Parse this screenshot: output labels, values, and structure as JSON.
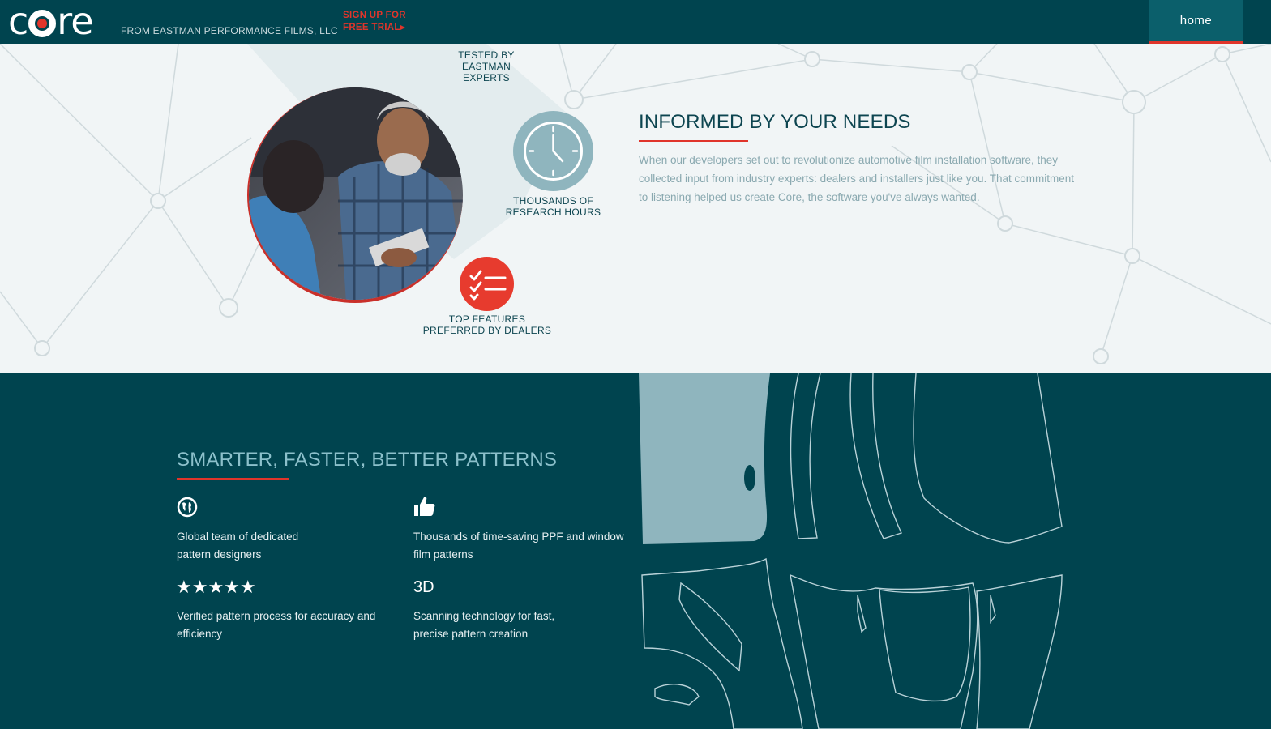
{
  "header": {
    "logo_text": "core",
    "tagline": "FROM EASTMAN PERFORMANCE FILMS, LLC",
    "signup_line1": "SIGN UP FOR",
    "signup_line2": "FREE TRIAL▸",
    "nav_home": "home"
  },
  "informed": {
    "features": [
      {
        "line1": "TESTED BY",
        "line2": "EASTMAN EXPERTS"
      },
      {
        "line1": "THOUSANDS OF",
        "line2": "RESEARCH HOURS",
        "icon": "clock-icon"
      },
      {
        "line1": "TOP FEATURES",
        "line2": "PREFERRED BY DEALERS",
        "icon": "checklist-icon"
      }
    ],
    "title": "INFORMED BY YOUR NEEDS",
    "body": "When our developers set out to revolutionize automotive film installation software, they collected input from industry experts: dealers and installers just like you. That commitment to listening helped us create Core, the software you've always wanted."
  },
  "patterns_section": {
    "title": "SMARTER, FASTER, BETTER PATTERNS",
    "items": [
      {
        "icon": "globe-icon",
        "line1": "Global team of dedicated",
        "line2": "pattern designers"
      },
      {
        "icon": "thumbs-up-icon",
        "line1": "Thousands of time-saving PPF and window",
        "line2": "film patterns"
      },
      {
        "icon": "five-stars-icon",
        "glyph": "★★★★★",
        "line1": "Verified pattern process for accuracy and",
        "line2": "efficiency"
      },
      {
        "icon": "3d-icon",
        "glyph": "3D",
        "line1": "Scanning technology for fast,",
        "line2": "precise pattern creation"
      }
    ]
  },
  "colors": {
    "brand_dark": "#00444f",
    "accent_red": "#e0352b",
    "muted_teal": "#8fb5be"
  }
}
